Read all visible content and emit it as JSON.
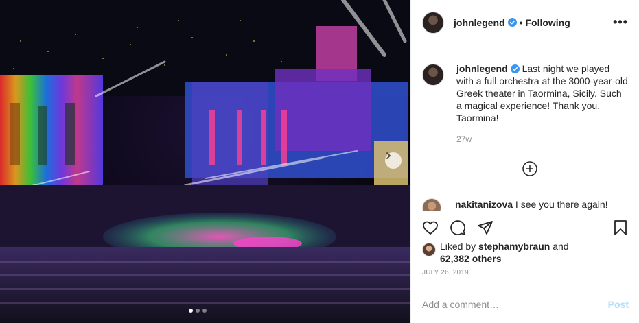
{
  "header": {
    "username": "johnlegend",
    "follow_status": "• Following",
    "more_label": "•••"
  },
  "caption": {
    "username": "johnlegend",
    "text": "Last night we played with a full orchestra at the 3000-year-old Greek theater in Taormina, Sicily. Such a magical experience! Thank you, Taormina!",
    "time_ago": "27w"
  },
  "comment": {
    "username": "nakitanizova",
    "text": "I see you there again!"
  },
  "likes": {
    "prefix": "Liked by",
    "user": "stephamybraun",
    "and": "and",
    "others": "62,382 others"
  },
  "post_date": "JULY 26, 2019",
  "add_comment": {
    "placeholder": "Add a comment…",
    "post_label": "Post"
  },
  "carousel": {
    "dot_count": 3,
    "active_index": 0
  },
  "icons": {
    "verified": "verified-badge-icon",
    "like": "heart-icon",
    "comment": "comment-icon",
    "share": "paper-plane-icon",
    "save": "bookmark-icon",
    "load_more": "plus-circle-icon",
    "next": "chevron-right-icon"
  },
  "colors": {
    "verified_blue": "#3897f0",
    "post_disabled": "#b2dffc",
    "muted_text": "#8e8e8e"
  }
}
